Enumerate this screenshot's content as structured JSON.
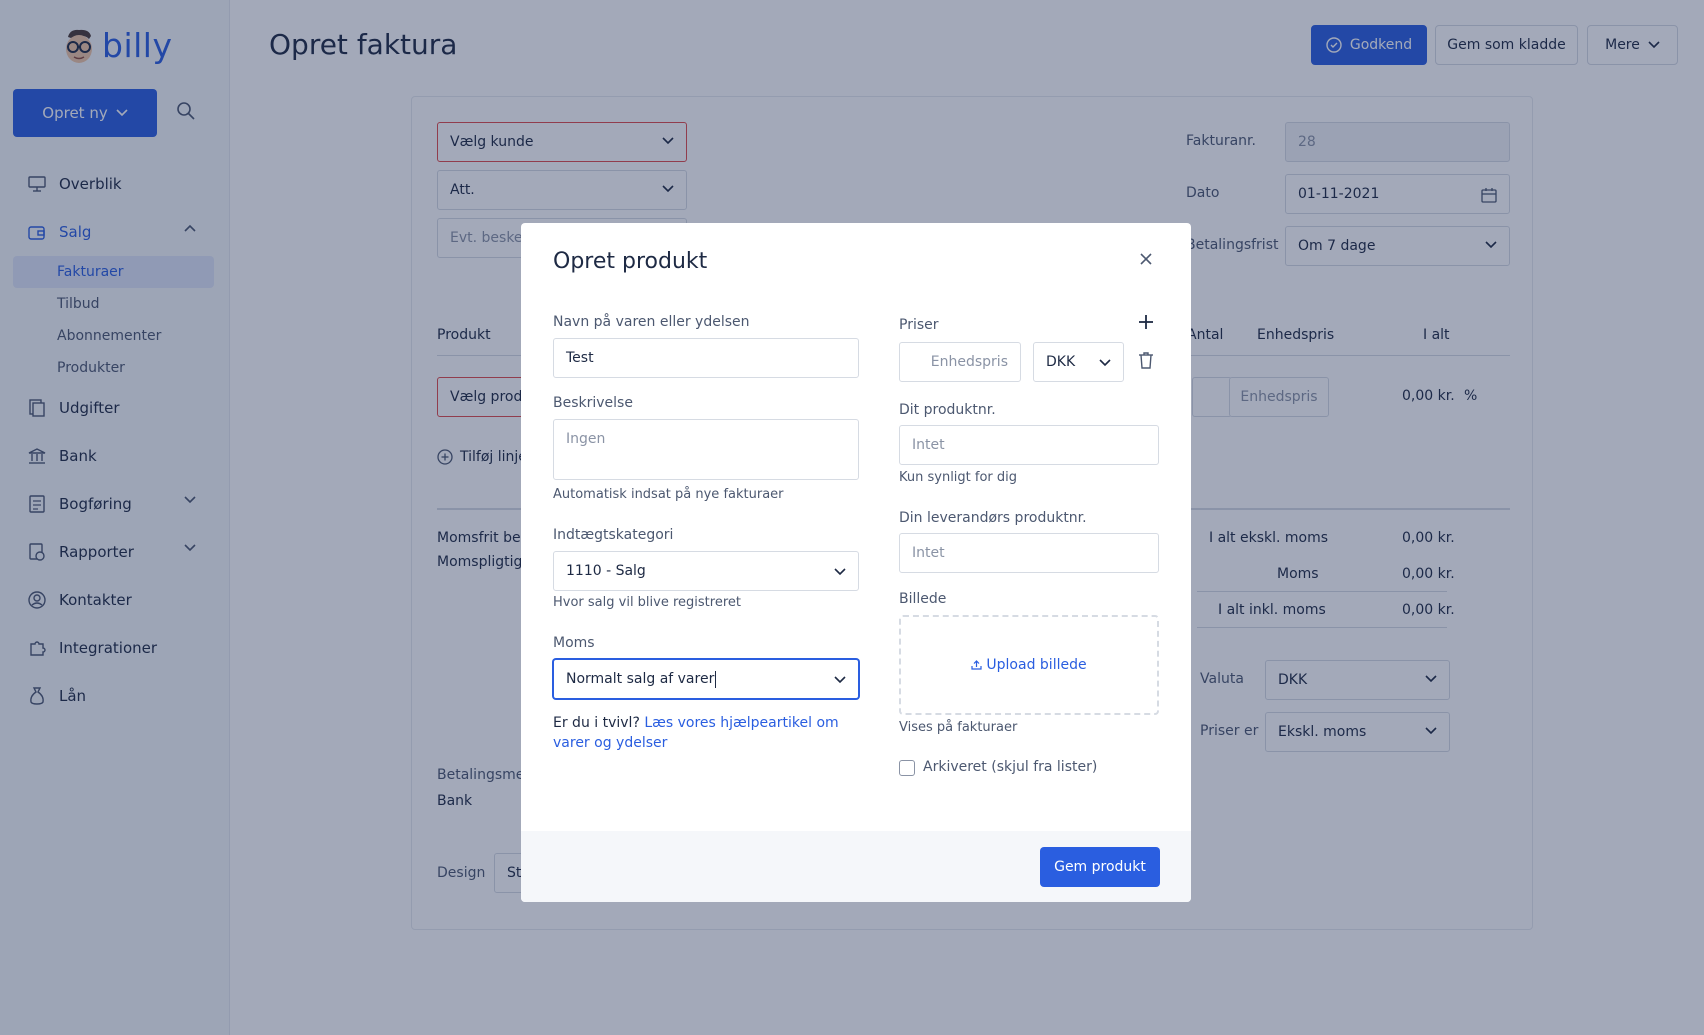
{
  "app": {
    "logo_text": "billy",
    "create_label": "Opret ny"
  },
  "sidebar": {
    "items": [
      {
        "label": "Overblik",
        "icon": "overview-icon"
      },
      {
        "label": "Salg",
        "icon": "sales-icon",
        "expanded": true
      },
      {
        "label": "Udgifter",
        "icon": "expenses-icon"
      },
      {
        "label": "Bank",
        "icon": "bank-icon"
      },
      {
        "label": "Bogføring",
        "icon": "bookkeeping-icon"
      },
      {
        "label": "Rapporter",
        "icon": "reports-icon"
      },
      {
        "label": "Kontakter",
        "icon": "contacts-icon"
      },
      {
        "label": "Integrationer",
        "icon": "integrations-icon"
      },
      {
        "label": "Lån",
        "icon": "loan-icon"
      }
    ],
    "sub_items": [
      "Fakturaer",
      "Tilbud",
      "Abonnementer",
      "Produkter"
    ]
  },
  "header": {
    "title": "Opret faktura",
    "approve_label": "Godkend",
    "draft_label": "Gem som kladde",
    "more_label": "Mere"
  },
  "invoice": {
    "customer_placeholder": "Vælg kunde",
    "att_placeholder": "Att.",
    "message_placeholder": "Evt. besked",
    "invoice_no_label": "Fakturanr.",
    "invoice_no": "28",
    "date_label": "Dato",
    "date": "01-11-2021",
    "due_label": "Betalingsfrist",
    "due_value": "Om 7 dage",
    "col_product": "Produkt",
    "col_qty": "Antal",
    "col_unit_price": "Enhedspris",
    "col_total": "I alt",
    "product_placeholder": "Vælg produkt",
    "unit_price_placeholder": "Enhedspris",
    "line_total": "0,00 kr.",
    "percent_symbol": "%",
    "add_line_label": "Tilføj linje",
    "vat_free_label": "Momsfrit beløb",
    "vat_liable_label": "Momspligtigt beløb",
    "total_excl_label": "I alt ekskl. moms",
    "total_excl": "0,00 kr.",
    "vat_label": "Moms",
    "vat": "0,00 kr.",
    "total_incl_label": "I alt inkl. moms",
    "total_incl": "0,00 kr.",
    "currency_label": "Valuta",
    "currency": "DKK",
    "prices_label": "Priser er",
    "prices_value": "Ekskl. moms",
    "payment_method_label": "Betalingsmetode",
    "payment_method": "Bank",
    "design_label": "Design",
    "design_value": "Standard"
  },
  "modal": {
    "title": "Opret produkt",
    "name_label": "Navn på varen eller ydelsen",
    "name_value": "Test",
    "desc_label": "Beskrivelse",
    "desc_placeholder": "Ingen",
    "desc_help": "Automatisk indsat på nye fakturaer",
    "category_label": "Indtægtskategori",
    "category_value": "1110 - Salg",
    "category_help": "Hvor salg vil blive registreret",
    "vat_label": "Moms",
    "vat_value": "Normalt salg af varer",
    "doubt_text": "Er du i tvivl?",
    "doubt_link": "Læs vores hjælpeartikel om varer og ydelser",
    "prices_label": "Priser",
    "unit_price_placeholder": "Enhedspris",
    "currency": "DKK",
    "product_no_label": "Dit produktnr.",
    "product_no_placeholder": "Intet",
    "product_no_help": "Kun synligt for dig",
    "supplier_no_label": "Din leverandørs produktnr.",
    "supplier_no_placeholder": "Intet",
    "image_label": "Billede",
    "upload_label": "Upload billede",
    "image_help": "Vises på fakturaer",
    "archived_label": "Arkiveret (skjul fra lister)",
    "save_label": "Gem produkt"
  },
  "colors": {
    "accent": "#2a5ee0",
    "error": "#e24b4b",
    "overlay": "rgba(25,40,80,0.40)"
  }
}
